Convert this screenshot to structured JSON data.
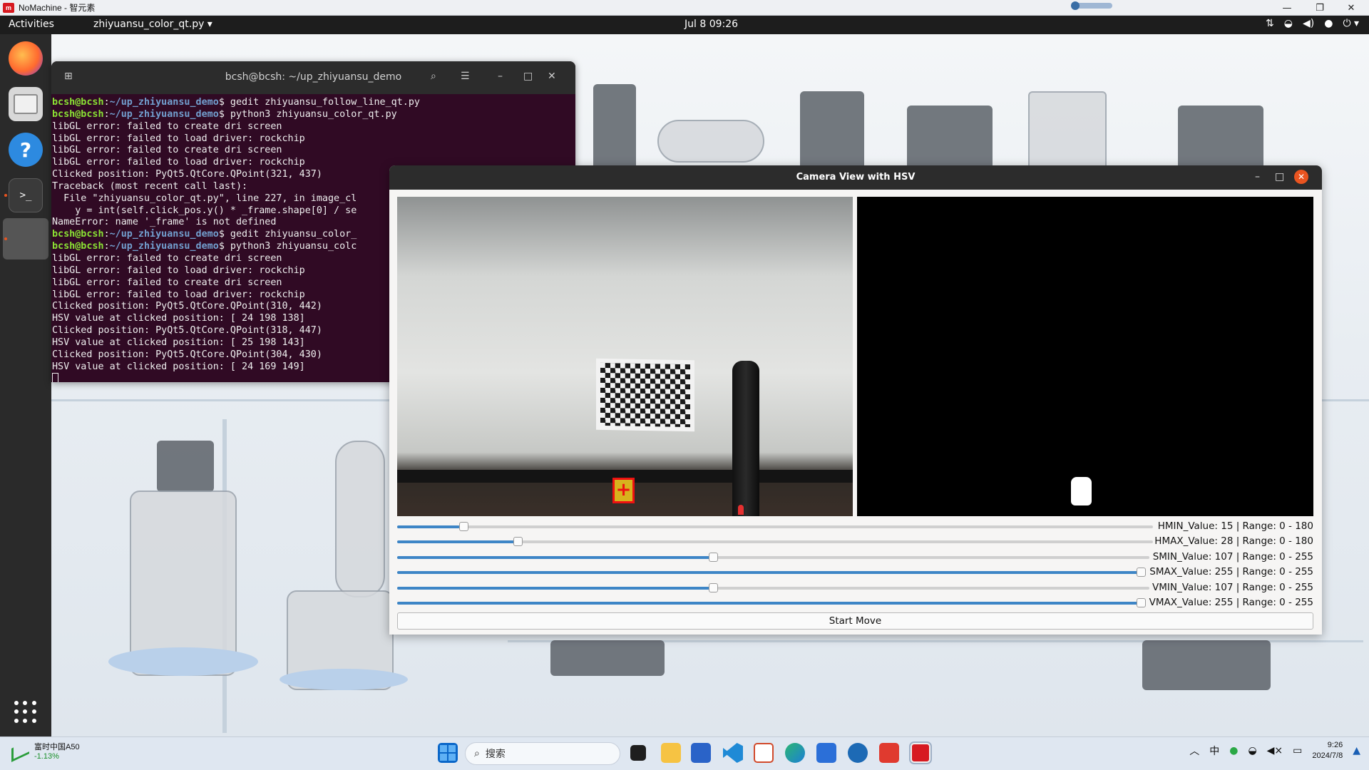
{
  "nomachine": {
    "title": "NoMachine - 智元素",
    "logo_text": "m",
    "controls": [
      "—",
      "❐",
      "✕"
    ]
  },
  "gnome": {
    "activities": "Activities",
    "app_menu": "zhiyuansu_color_qt.py ▾",
    "clock": "Jul 8  09:26",
    "tray_icons": [
      "network-icon",
      "wifi-icon",
      "volume-icon",
      "mic-icon",
      "power-icon"
    ]
  },
  "terminal": {
    "title": "bcsh@bcsh: ~/up_zhiyuansu_demo",
    "prompt_user": "bcsh@bcsh",
    "prompt_path": "~/up_zhiyuansu_demo",
    "lines": [
      {
        "prompt": true,
        "cmd": "$ gedit zhiyuansu_follow_line_qt.py"
      },
      {
        "prompt": true,
        "cmd": "$ python3 zhiyuansu_color_qt.py"
      },
      {
        "text": "libGL error: failed to create dri screen"
      },
      {
        "text": "libGL error: failed to load driver: rockchip"
      },
      {
        "text": "libGL error: failed to create dri screen"
      },
      {
        "text": "libGL error: failed to load driver: rockchip"
      },
      {
        "text": "Clicked position: PyQt5.QtCore.QPoint(321, 437)"
      },
      {
        "text": "Traceback (most recent call last):"
      },
      {
        "text": "  File \"zhiyuansu_color_qt.py\", line 227, in image_cl"
      },
      {
        "text": "    y = int(self.click_pos.y() * _frame.shape[0] / se"
      },
      {
        "text": "NameError: name '_frame' is not defined"
      },
      {
        "prompt": true,
        "cmd": "$ gedit zhiyuansu_color_"
      },
      {
        "prompt": true,
        "cmd": "$ python3 zhiyuansu_colc"
      },
      {
        "text": "libGL error: failed to create dri screen"
      },
      {
        "text": "libGL error: failed to load driver: rockchip"
      },
      {
        "text": "libGL error: failed to create dri screen"
      },
      {
        "text": "libGL error: failed to load driver: rockchip"
      },
      {
        "text": "Clicked position: PyQt5.QtCore.QPoint(310, 442)"
      },
      {
        "text": "HSV value at clicked position: [ 24 198 138]"
      },
      {
        "text": "Clicked position: PyQt5.QtCore.QPoint(318, 447)"
      },
      {
        "text": "HSV value at clicked position: [ 25 198 143]"
      },
      {
        "text": "Clicked position: PyQt5.QtCore.QPoint(304, 430)"
      },
      {
        "text": "HSV value at clicked position: [ 24 169 149]"
      }
    ]
  },
  "camera_window": {
    "title": "Camera View with HSV",
    "sliders": [
      {
        "name": "HMIN",
        "label": "HMIN_Value: 15 | Range: 0 - 180",
        "value": 15,
        "min": 0,
        "max": 180
      },
      {
        "name": "HMAX",
        "label": "HMAX_Value: 28 | Range: 0 - 180",
        "value": 28,
        "min": 0,
        "max": 180
      },
      {
        "name": "SMIN",
        "label": "SMIN_Value: 107 | Range: 0 - 255",
        "value": 107,
        "min": 0,
        "max": 255
      },
      {
        "name": "SMAX",
        "label": "SMAX_Value: 255 | Range: 0 - 255",
        "value": 255,
        "min": 0,
        "max": 255
      },
      {
        "name": "VMIN",
        "label": "VMIN_Value: 107 | Range: 0 - 255",
        "value": 107,
        "min": 0,
        "max": 255
      },
      {
        "name": "VMAX",
        "label": "VMAX_Value: 255 | Range: 0 - 255",
        "value": 255,
        "min": 0,
        "max": 255
      }
    ],
    "start_button": "Start Move",
    "marker_glyph": "+"
  },
  "taskbar": {
    "widget_name": "富时中国A50",
    "widget_change": "-1.13%",
    "search_placeholder": "搜索",
    "ime": "中",
    "clock_time": "9:26",
    "clock_date": "2024/7/8",
    "apps": [
      "windows-start-icon",
      "file-explorer-icon",
      "microsoft-store-icon",
      "vscode-icon",
      "edge-icon",
      "wps-icon",
      "nomachine-icon"
    ]
  },
  "colors": {
    "terminal_bg": "#300a24",
    "prompt_green": "#8ae234",
    "prompt_blue": "#729fcf",
    "ubuntu_orange": "#e95420",
    "slider_blue": "#3d85c6"
  }
}
